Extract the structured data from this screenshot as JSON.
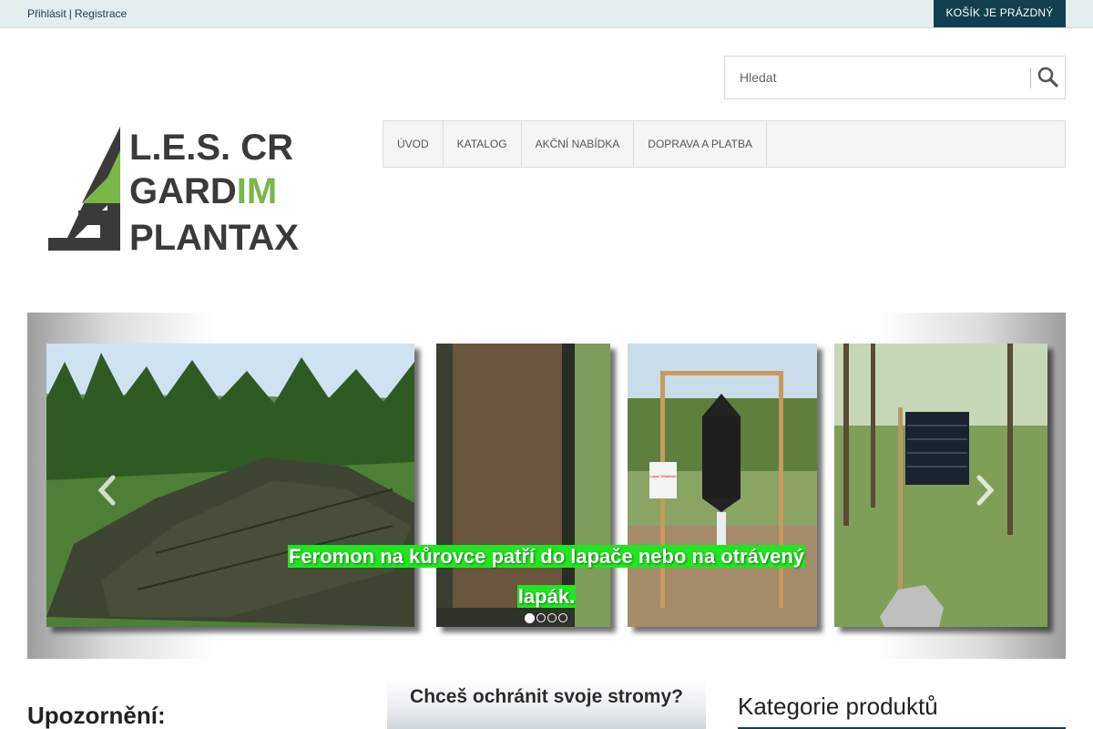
{
  "topbar": {
    "login": "Přihlásit",
    "separator": "|",
    "register": "Registrace",
    "cart_label": "KOŠÍK JE PRÁZDNÝ"
  },
  "search": {
    "placeholder": "Hledat",
    "icon": "search-icon"
  },
  "logo": {
    "line1": "L.E.S. CR",
    "line2a": "GARD",
    "line2b": "IM",
    "line3": "PLANTAX",
    "accent_color": "#7ab648",
    "dark_color": "#3a3a3a"
  },
  "nav": {
    "items": [
      {
        "label": "ÚVOD"
      },
      {
        "label": "KATALOG"
      },
      {
        "label": "AKČNÍ NABÍDKA"
      },
      {
        "label": "DOPRAVA A PLATBA"
      }
    ]
  },
  "slider": {
    "caption": "Feromon na kůrovce patří do lapače nebo na otrávený lapák.",
    "caption_bg": "#21e521",
    "prev_icon": "chevron-left-icon",
    "next_icon": "chevron-right-icon",
    "slide_count": 4,
    "active_slide": 1,
    "trap_sign_text": "Lapač Wiltaflash"
  },
  "content": {
    "notice_title": "Upozornění:",
    "banner_text": "Chceš ochránit svoje stromy?",
    "categories_title": "Kategorie produktů"
  },
  "colors": {
    "topbar_bg": "#e4eef0",
    "cart_bg": "#123f4f",
    "nav_bg": "#f5f5f5"
  }
}
